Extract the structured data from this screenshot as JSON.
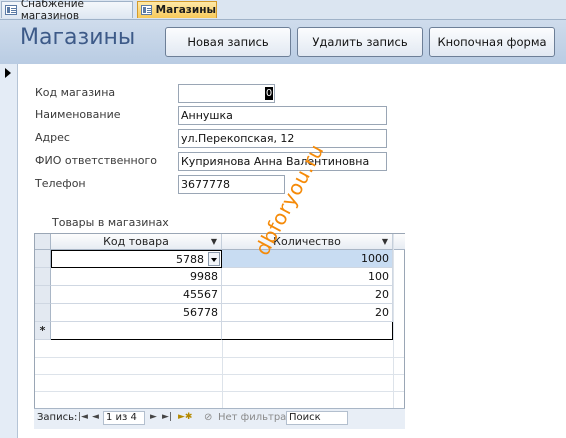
{
  "tabs": [
    {
      "label": "Снабжение магазинов",
      "active": false
    },
    {
      "label": "Магазины",
      "active": true
    }
  ],
  "form": {
    "title": "Магазины",
    "buttons": {
      "new_record": "Новая запись",
      "delete_record": "Удалить запись",
      "switchboard": "Кнопочная форма"
    },
    "fields": {
      "code": {
        "label": "Код магазина",
        "value": "0"
      },
      "name": {
        "label": "Наименование",
        "value": "Аннушка"
      },
      "address": {
        "label": "Адрес",
        "value": "ул.Перекопская, 12"
      },
      "manager": {
        "label": "ФИО ответственного",
        "value": "Куприянова Анна Валентиновна"
      },
      "phone": {
        "label": "Телефон",
        "value": "3677778"
      }
    }
  },
  "subform": {
    "caption": "Товары в магазинах",
    "columns": [
      "Код товара",
      "Количество"
    ],
    "rows": [
      {
        "code": "5788",
        "qty": "1000"
      },
      {
        "code": "9988",
        "qty": "100"
      },
      {
        "code": "45567",
        "qty": "20"
      },
      {
        "code": "56778",
        "qty": "20"
      }
    ],
    "new_row_marker": "*"
  },
  "navigation": {
    "record_label": "Запись:",
    "record_position": "1 из 4",
    "filter_label": "Нет фильтра",
    "search_placeholder": "Поиск"
  },
  "watermark": "dbforyou.ru"
}
